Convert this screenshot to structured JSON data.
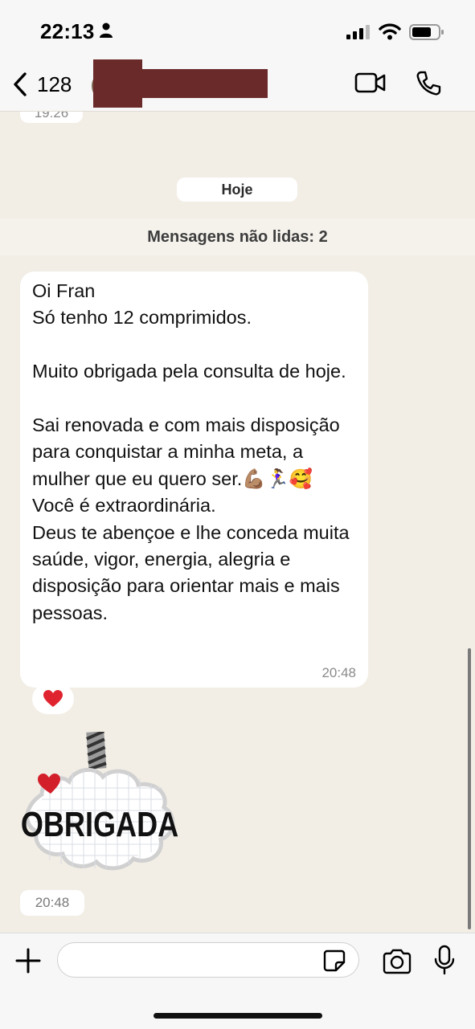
{
  "status_bar": {
    "time": "22:13"
  },
  "header": {
    "back_count": "128"
  },
  "chat": {
    "previous_time": "19:26",
    "date_chip": "Hoje",
    "unread_banner": "Mensagens não lidas: 2",
    "message": {
      "text": "Oi Fran\nSó tenho 12 comprimidos.\n\nMuito obrigada pela consulta de hoje.\n\nSai renovada e com mais disposição para conquistar a minha meta, a mulher que eu quero ser.💪🏽🏃‍♀️🥰\nVocê é extraordinária.\nDeus te abençoe e lhe conceda muita saúde, vigor, energia, alegria e disposição para orientar mais e mais pessoas.",
      "time": "20:48",
      "reaction": "❤️"
    },
    "sticker": {
      "text": "OBRIGADA",
      "time": "20:48"
    }
  },
  "composer": {
    "placeholder": "",
    "value": ""
  },
  "colors": {
    "background": "#f2eee6",
    "bubble": "#ffffff",
    "redaction": "#6b2a2a"
  },
  "icons": [
    "person-icon",
    "signal-icon",
    "wifi-icon",
    "battery-icon",
    "back-chevron-icon",
    "video-call-icon",
    "phone-icon",
    "plus-icon",
    "sticker-icon",
    "camera-icon",
    "microphone-icon"
  ]
}
